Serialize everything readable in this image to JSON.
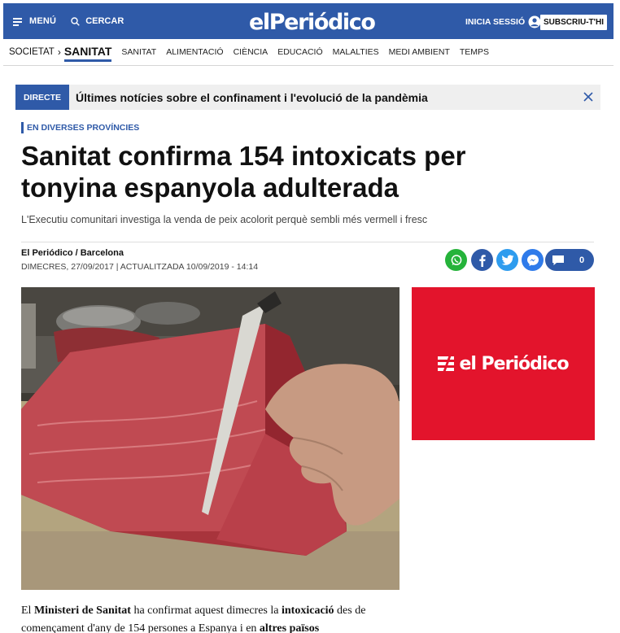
{
  "header": {
    "menu_label": "MENÚ",
    "search_label": "CERCAR",
    "logo": "elPeriódico",
    "login_label": "INICIA SESSIÓ",
    "subscribe_label": "SUBSCRIU-T'HI",
    "brand_color": "#2f5aa8"
  },
  "section_nav": {
    "parent": "SOCIETAT",
    "current": "SANITAT",
    "items": [
      "SANITAT",
      "ALIMENTACIÓ",
      "CIÈNCIA",
      "EDUCACIÓ",
      "MALALTIES",
      "MEDI AMBIENT",
      "TEMPS"
    ]
  },
  "live_banner": {
    "tag": "DIRECTE",
    "text": "Últimes notícies sobre el confinament i l'evolució de la pandèmia"
  },
  "article": {
    "kicker": "EN DIVERSES PROVÍNCIES",
    "headline": "Sanitat confirma 154 intoxicats per tonyina espanyola adulterada",
    "subhead": "L'Executiu comunitari investiga la venda de peix acolorit perquè sembli més vermell i fresc",
    "author": "El Periódico / Barcelona",
    "dateline": "DIMECRES, 27/09/2017 | ACTUALITZADA 10/09/2019 - 14:14",
    "comment_count": "0",
    "body": {
      "p1": "El ",
      "b1": "Ministeri de Sanitat",
      "p2": " ha confirmat aquest dimecres la ",
      "b2": "intoxicació",
      "p3": " des de començament d'any de 154 persones a Espanya i en ",
      "b3": "altres països"
    }
  },
  "share_icons": [
    "whatsapp-icon",
    "facebook-icon",
    "twitter-icon",
    "messenger-icon",
    "comment-icon"
  ],
  "ad": {
    "logo": "el Periódico",
    "background": "#e3142c"
  }
}
